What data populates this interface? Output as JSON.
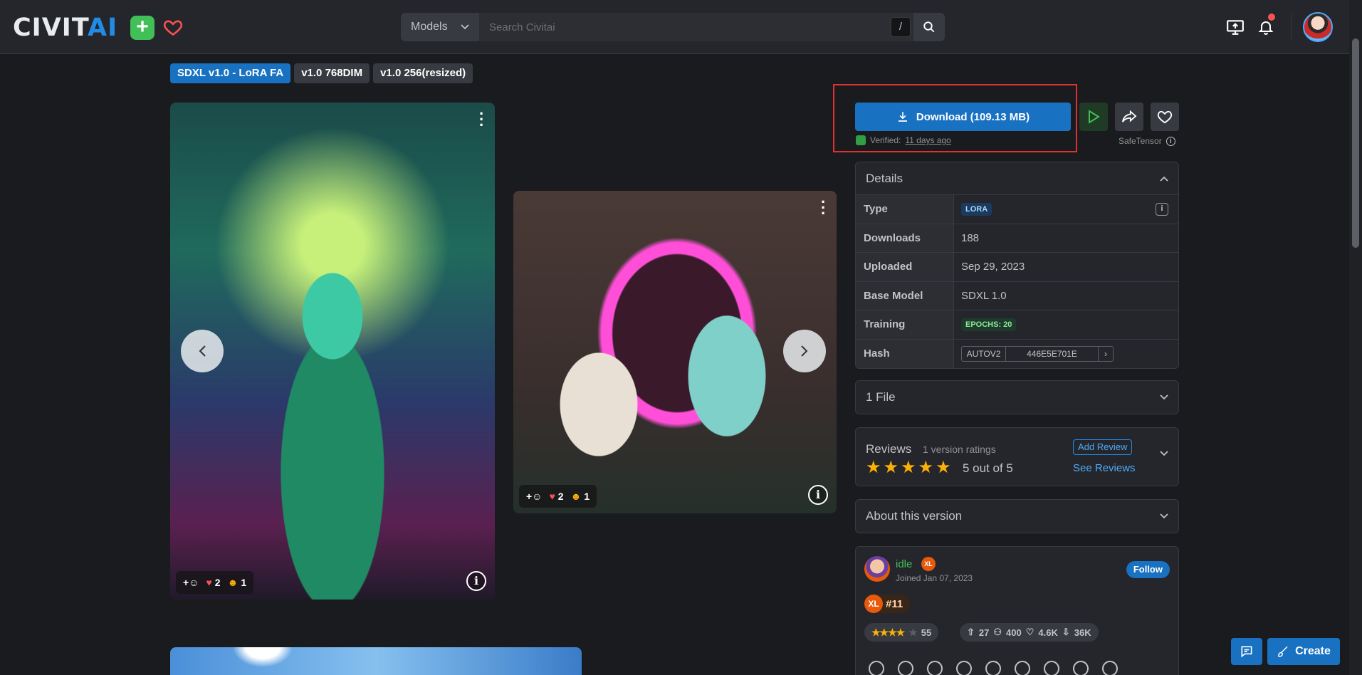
{
  "header": {
    "logo_main": "CIVIT",
    "logo_ai": "AI",
    "search_category": "Models",
    "search_placeholder": "Search Civitai",
    "search_shortcut": "/"
  },
  "version_tabs": [
    {
      "label": "SDXL v1.0 - LoRA FA",
      "active": true
    },
    {
      "label": "v1.0 768DIM",
      "active": false
    },
    {
      "label": "v1.0 256(resized)",
      "active": false
    }
  ],
  "images": [
    {
      "reactions": {
        "hearts": "2",
        "laugh": "1"
      }
    },
    {
      "reactions": {
        "hearts": "2",
        "laugh": "1"
      }
    }
  ],
  "download": {
    "label": "Download (109.13 MB)",
    "verified_prefix": "Verified:",
    "verified_time": "11 days ago",
    "safetensor": "SafeTensor"
  },
  "details": {
    "title": "Details",
    "type_label": "Type",
    "type_value": "LORA",
    "downloads_label": "Downloads",
    "downloads_value": "188",
    "uploaded_label": "Uploaded",
    "uploaded_value": "Sep 29, 2023",
    "base_label": "Base Model",
    "base_value": "SDXL 1.0",
    "training_label": "Training",
    "training_value": "EPOCHS: 20",
    "hash_label": "Hash",
    "hash_type": "AUTOV2",
    "hash_value": "446E5E701E"
  },
  "files": {
    "title": "1 File"
  },
  "reviews": {
    "title": "Reviews",
    "count": "1 version ratings",
    "rating_text": "5 out of 5",
    "rating": 5,
    "add_review": "Add Review",
    "see_reviews": "See Reviews"
  },
  "about": {
    "title": "About this version"
  },
  "creator": {
    "name": "idle",
    "badge": "XL",
    "joined": "Joined Jan 07, 2023",
    "follow": "Follow",
    "rank_badge": "XL",
    "rank": "#11",
    "rating_count": "55",
    "uploads": "27",
    "followers": "400",
    "likes": "4.6K",
    "downloads": "36K"
  },
  "fab": {
    "create": "Create"
  },
  "colors": {
    "accent": "#1971c2",
    "star": "#fab005",
    "success": "#40c057"
  }
}
